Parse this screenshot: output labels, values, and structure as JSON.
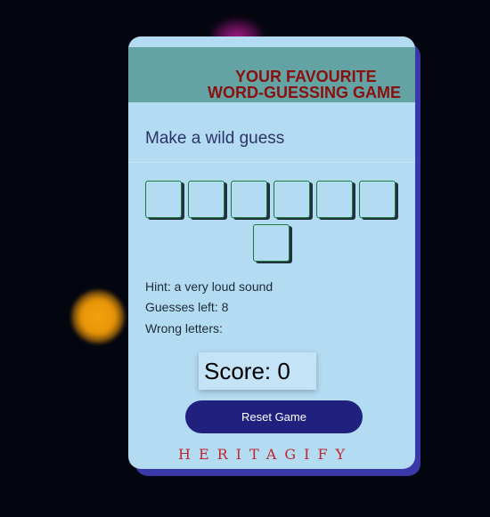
{
  "header": {
    "title_line1": "YOUR FAVOURITE",
    "title_line2": "WORD-GUESSING GAME"
  },
  "prompt": "Make a wild guess",
  "word_tiles": {
    "count": 7,
    "letters": [
      "",
      "",
      "",
      "",
      "",
      "",
      ""
    ]
  },
  "info": {
    "hint": "Hint: a very loud sound",
    "guesses_left": "Guesses left: 8",
    "wrong_letters": "Wrong letters:"
  },
  "score": "Score: 0",
  "reset_label": "Reset Game",
  "brand": "HERITAGIFY",
  "colors": {
    "background": "#04060f",
    "card": "#b3dbf2",
    "card_shadow": "#3a38a8",
    "header": "#64a3a3",
    "title": "#8a0f0f",
    "button": "#20207e",
    "brand": "#c0262a"
  }
}
